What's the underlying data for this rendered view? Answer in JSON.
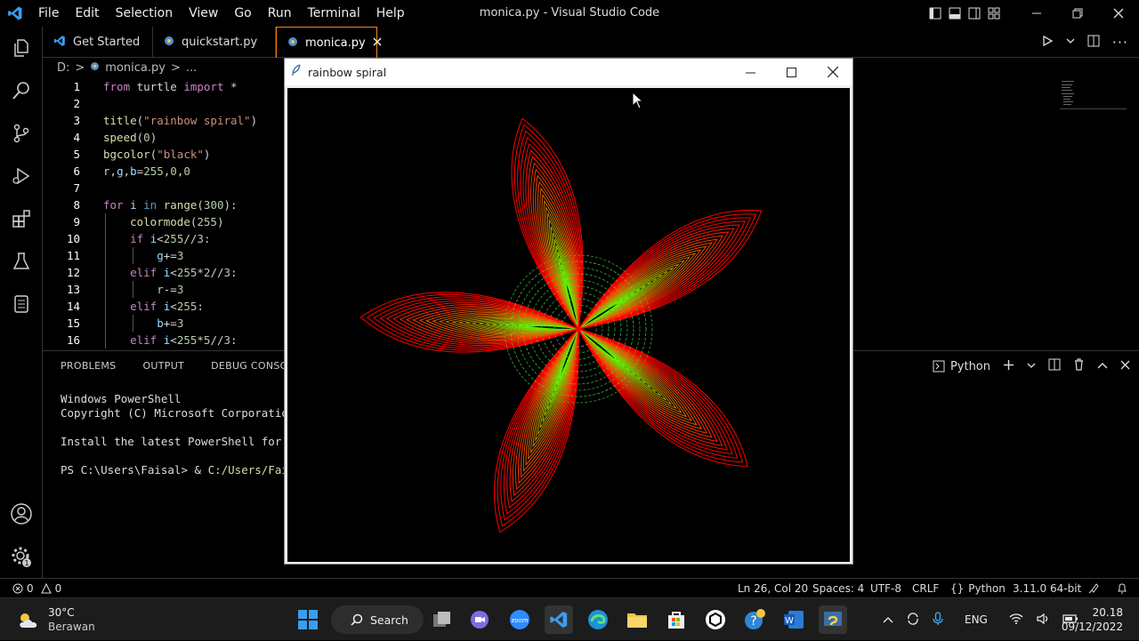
{
  "window": {
    "title": "monica.py - Visual Studio Code",
    "menu": [
      "File",
      "Edit",
      "Selection",
      "View",
      "Go",
      "Run",
      "Terminal",
      "Help"
    ]
  },
  "tabs": [
    {
      "label": "Get Started",
      "icon": "vscode-icon"
    },
    {
      "label": "quickstart.py",
      "icon": "python-icon"
    },
    {
      "label": "monica.py",
      "icon": "python-icon",
      "active": true
    }
  ],
  "breadcrumb": {
    "drive": "D:",
    "sep": ">",
    "file": "monica.py",
    "more": "..."
  },
  "editor": {
    "line_numbers": [
      "1",
      "2",
      "3",
      "4",
      "5",
      "6",
      "7",
      "8",
      "9",
      "10",
      "11",
      "12",
      "13",
      "14",
      "15",
      "16"
    ],
    "lines": [
      [
        {
          "t": "from",
          "c": "kw2"
        },
        {
          "t": " turtle ",
          "c": "op"
        },
        {
          "t": "import",
          "c": "kw2"
        },
        {
          "t": " *",
          "c": "op"
        }
      ],
      [],
      [
        {
          "t": "title",
          "c": "fn"
        },
        {
          "t": "(",
          "c": "op"
        },
        {
          "t": "\"rainbow spiral\"",
          "c": "str"
        },
        {
          "t": ")",
          "c": "op"
        }
      ],
      [
        {
          "t": "speed",
          "c": "fn"
        },
        {
          "t": "(",
          "c": "op"
        },
        {
          "t": "0",
          "c": "num"
        },
        {
          "t": ")",
          "c": "op"
        }
      ],
      [
        {
          "t": "bgcolor",
          "c": "fn"
        },
        {
          "t": "(",
          "c": "op"
        },
        {
          "t": "\"black\"",
          "c": "str"
        },
        {
          "t": ")",
          "c": "op"
        }
      ],
      [
        {
          "t": "r",
          "c": "var"
        },
        {
          "t": ",",
          "c": "op"
        },
        {
          "t": "g",
          "c": "var"
        },
        {
          "t": ",",
          "c": "op"
        },
        {
          "t": "b",
          "c": "var"
        },
        {
          "t": "=",
          "c": "op"
        },
        {
          "t": "255",
          "c": "num"
        },
        {
          "t": ",",
          "c": "op"
        },
        {
          "t": "0",
          "c": "num"
        },
        {
          "t": ",",
          "c": "op"
        },
        {
          "t": "0",
          "c": "num"
        }
      ],
      [],
      [
        {
          "t": "for",
          "c": "kw2"
        },
        {
          "t": " i ",
          "c": "var"
        },
        {
          "t": "in",
          "c": "kw"
        },
        {
          "t": " ",
          "c": "op"
        },
        {
          "t": "range",
          "c": "fn"
        },
        {
          "t": "(",
          "c": "op"
        },
        {
          "t": "300",
          "c": "num"
        },
        {
          "t": "):",
          "c": "op"
        }
      ],
      [
        {
          "t": "    ",
          "c": "op"
        },
        {
          "t": "colormode",
          "c": "fn"
        },
        {
          "t": "(",
          "c": "op"
        },
        {
          "t": "255",
          "c": "num"
        },
        {
          "t": ")",
          "c": "op"
        }
      ],
      [
        {
          "t": "    ",
          "c": "op"
        },
        {
          "t": "if",
          "c": "kw2"
        },
        {
          "t": " i",
          "c": "var"
        },
        {
          "t": "<",
          "c": "op"
        },
        {
          "t": "255",
          "c": "num"
        },
        {
          "t": "//",
          "c": "op"
        },
        {
          "t": "3",
          "c": "num"
        },
        {
          "t": ":",
          "c": "op"
        }
      ],
      [
        {
          "t": "        ",
          "c": "op"
        },
        {
          "t": "g",
          "c": "var"
        },
        {
          "t": "+=",
          "c": "op"
        },
        {
          "t": "3",
          "c": "num"
        }
      ],
      [
        {
          "t": "    ",
          "c": "op"
        },
        {
          "t": "elif",
          "c": "kw2"
        },
        {
          "t": " i",
          "c": "var"
        },
        {
          "t": "<",
          "c": "op"
        },
        {
          "t": "255",
          "c": "num"
        },
        {
          "t": "*",
          "c": "op"
        },
        {
          "t": "2",
          "c": "num"
        },
        {
          "t": "//",
          "c": "op"
        },
        {
          "t": "3",
          "c": "num"
        },
        {
          "t": ":",
          "c": "op"
        }
      ],
      [
        {
          "t": "        ",
          "c": "op"
        },
        {
          "t": "r",
          "c": "var"
        },
        {
          "t": "-=",
          "c": "op"
        },
        {
          "t": "3",
          "c": "num"
        }
      ],
      [
        {
          "t": "    ",
          "c": "op"
        },
        {
          "t": "elif",
          "c": "kw2"
        },
        {
          "t": " i",
          "c": "var"
        },
        {
          "t": "<",
          "c": "op"
        },
        {
          "t": "255",
          "c": "num"
        },
        {
          "t": ":",
          "c": "op"
        }
      ],
      [
        {
          "t": "        ",
          "c": "op"
        },
        {
          "t": "b",
          "c": "var"
        },
        {
          "t": "+=",
          "c": "op"
        },
        {
          "t": "3",
          "c": "num"
        }
      ],
      [
        {
          "t": "    ",
          "c": "op"
        },
        {
          "t": "elif",
          "c": "kw2"
        },
        {
          "t": " i",
          "c": "var"
        },
        {
          "t": "<",
          "c": "op"
        },
        {
          "t": "255",
          "c": "num"
        },
        {
          "t": "*",
          "c": "op"
        },
        {
          "t": "5",
          "c": "num"
        },
        {
          "t": "//",
          "c": "op"
        },
        {
          "t": "3",
          "c": "num"
        },
        {
          "t": ":",
          "c": "op"
        }
      ]
    ]
  },
  "panel": {
    "tabs": [
      "PROBLEMS",
      "OUTPUT",
      "DEBUG CONSOLE"
    ],
    "shell": "Python",
    "terminal": [
      "Windows PowerShell",
      "Copyright (C) Microsoft Corporation",
      "",
      "Install the latest PowerShell for n",
      "",
      "PS C:\\Users\\Faisal> & "
    ],
    "terminal_path": "C:/Users/Fais"
  },
  "turtle_window": {
    "title": "rainbow spiral"
  },
  "statusbar": {
    "errors": "0",
    "warnings": "0",
    "position": "Ln 26, Col 20",
    "spaces": "Spaces: 4",
    "encoding": "UTF-8",
    "eol": "CRLF",
    "language": "Python",
    "interpreter": "3.11.0 64-bit"
  },
  "taskbar": {
    "weather_temp": "30°C",
    "weather_desc": "Berawan",
    "search_label": "Search",
    "lang": "ENG",
    "time": "20.18",
    "date": "09/12/2022"
  },
  "colors": {
    "accent": "#f38518",
    "vscode_blue": "#3c9cf0"
  }
}
